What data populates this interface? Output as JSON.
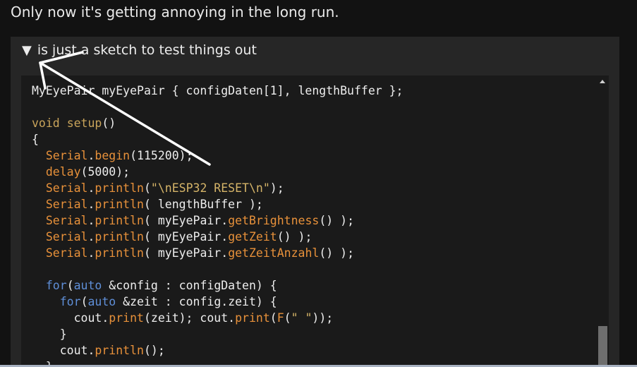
{
  "intro_text": "Only now it's getting annoying in the long run.",
  "summary": {
    "toggle_glyph": "▼",
    "label": "is just a sketch to test things out"
  },
  "code_lines": [
    [
      {
        "t": "MyEyePair myEyePair { configDaten[1], lengthBuffer };"
      }
    ],
    [],
    [
      {
        "t": "void",
        "c": "kw"
      },
      {
        "t": " "
      },
      {
        "t": "setup",
        "c": "kw"
      },
      {
        "t": "()"
      }
    ],
    [
      {
        "t": "{"
      }
    ],
    [
      {
        "t": "  "
      },
      {
        "t": "Serial",
        "c": "fn"
      },
      {
        "t": "."
      },
      {
        "t": "begin",
        "c": "fn"
      },
      {
        "t": "(115200);"
      }
    ],
    [
      {
        "t": "  "
      },
      {
        "t": "delay",
        "c": "fn"
      },
      {
        "t": "(5000);"
      }
    ],
    [
      {
        "t": "  "
      },
      {
        "t": "Serial",
        "c": "fn"
      },
      {
        "t": "."
      },
      {
        "t": "println",
        "c": "fn"
      },
      {
        "t": "("
      },
      {
        "t": "\"\\nESP32 RESET\\n\"",
        "c": "st"
      },
      {
        "t": ");"
      }
    ],
    [
      {
        "t": "  "
      },
      {
        "t": "Serial",
        "c": "fn"
      },
      {
        "t": "."
      },
      {
        "t": "println",
        "c": "fn"
      },
      {
        "t": "( lengthBuffer );"
      }
    ],
    [
      {
        "t": "  "
      },
      {
        "t": "Serial",
        "c": "fn"
      },
      {
        "t": "."
      },
      {
        "t": "println",
        "c": "fn"
      },
      {
        "t": "( myEyePair."
      },
      {
        "t": "getBrightness",
        "c": "fn"
      },
      {
        "t": "() );"
      }
    ],
    [
      {
        "t": "  "
      },
      {
        "t": "Serial",
        "c": "fn"
      },
      {
        "t": "."
      },
      {
        "t": "println",
        "c": "fn"
      },
      {
        "t": "( myEyePair."
      },
      {
        "t": "getZeit",
        "c": "fn"
      },
      {
        "t": "() );"
      }
    ],
    [
      {
        "t": "  "
      },
      {
        "t": "Serial",
        "c": "fn"
      },
      {
        "t": "."
      },
      {
        "t": "println",
        "c": "fn"
      },
      {
        "t": "( myEyePair."
      },
      {
        "t": "getZeitAnzahl",
        "c": "fn"
      },
      {
        "t": "() );"
      }
    ],
    [],
    [
      {
        "t": "  "
      },
      {
        "t": "for",
        "c": "fl"
      },
      {
        "t": "("
      },
      {
        "t": "auto",
        "c": "fl"
      },
      {
        "t": " &config : configDaten) {"
      }
    ],
    [
      {
        "t": "    "
      },
      {
        "t": "for",
        "c": "fl"
      },
      {
        "t": "("
      },
      {
        "t": "auto",
        "c": "fl"
      },
      {
        "t": " &zeit : config.zeit) {"
      }
    ],
    [
      {
        "t": "      cout."
      },
      {
        "t": "print",
        "c": "fn"
      },
      {
        "t": "(zeit); cout."
      },
      {
        "t": "print",
        "c": "fn"
      },
      {
        "t": "("
      },
      {
        "t": "F",
        "c": "fn"
      },
      {
        "t": "("
      },
      {
        "t": "\" \"",
        "c": "st"
      },
      {
        "t": "));"
      }
    ],
    [
      {
        "t": "    }"
      }
    ],
    [
      {
        "t": "    cout."
      },
      {
        "t": "println",
        "c": "fn"
      },
      {
        "t": "();"
      }
    ],
    [
      {
        "t": "  }"
      }
    ]
  ],
  "colors": {
    "page_background": "#121212",
    "details_background": "#262626",
    "code_background": "#1a1a1a",
    "keyword": "#c9a45a",
    "function": "#e8913a",
    "control_flow": "#5f8fd8",
    "string": "#d5b468",
    "annotation_arrow": "#ffffff"
  }
}
